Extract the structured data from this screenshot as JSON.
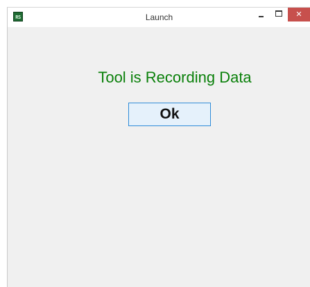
{
  "window": {
    "title": "Launch",
    "app_icon_text": "RS"
  },
  "titlebar_buttons": {
    "minimize": "minimize-icon",
    "maximize": "maximize-icon",
    "close": "close-icon",
    "close_glyph": "✕"
  },
  "main": {
    "message": "Tool is Recording Data",
    "ok_label": "Ok"
  },
  "colors": {
    "message": "#0a800a",
    "close_button": "#c7504d",
    "ok_border": "#2e8bd8",
    "ok_background": "#e5f1fb",
    "client_background": "#f0f0f0"
  }
}
